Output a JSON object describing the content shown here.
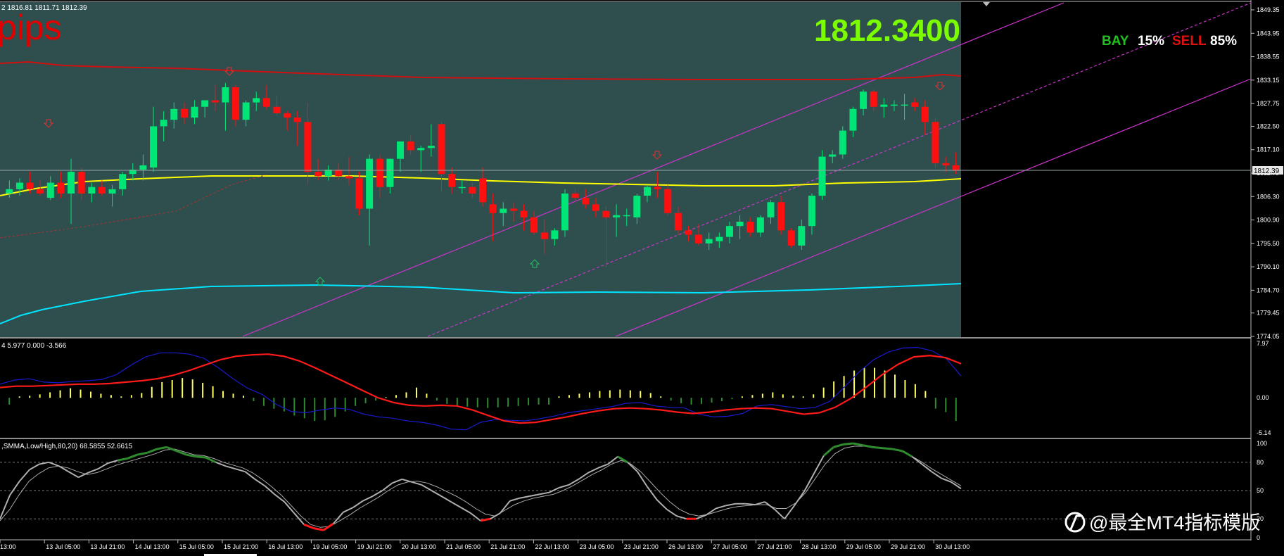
{
  "header": {
    "ohlc_text": "2 1816.81 1811.71 1812.39",
    "pips_label": "pips",
    "price_big": "1812.3400",
    "bay_label": "BAY",
    "bay_pct": "15%",
    "sell_label": "SELL",
    "sell_pct": "85%"
  },
  "macd": {
    "label": "4 5.977 0.000 -3.566"
  },
  "stoch": {
    "label": ",SMMA,Low/High,80,20) 68.5855 52.6615"
  },
  "current_price_tag": "1812.39",
  "watermark": "@最全MT4指标模版",
  "colors": {
    "bull": "#00e676",
    "bear": "#ff1010",
    "main_bg": "#2f4f4f",
    "yellow": "#ffff00",
    "cyan": "#00e5ff",
    "band_red": "#d01010",
    "channel": "#cc33cc",
    "pips": "#e00000",
    "big_price": "#7cfc00"
  },
  "chart_data": {
    "type": "candlestick",
    "price_axis": {
      "range": [
        1774.05,
        1849.35
      ],
      "ticks": [
        "1849.35",
        "1843.95",
        "1838.55",
        "1833.15",
        "1827.75",
        "1822.50",
        "1817.10",
        "1811.70",
        "1806.30",
        "1800.90",
        "1795.50",
        "1790.10",
        "1784.70",
        "1779.45",
        "1774.05"
      ]
    },
    "macd_axis": {
      "ticks": [
        "7.97",
        "0.00",
        "-5.14"
      ]
    },
    "stoch_axis": {
      "ticks": [
        "100",
        "80",
        "50",
        "20",
        "0"
      ]
    },
    "time_axis": {
      "ticks": [
        "13:00",
        "13 Jul 05:00",
        "13 Jul 21:00",
        "14 Jul 13:00",
        "15 Jul 05:00",
        "15 Jul 21:00",
        "16 Jul 13:00",
        "19 Jul 05:00",
        "19 Jul 21:00",
        "20 Jul 13:00",
        "21 Jul 05:00",
        "21 Jul 21:00",
        "22 Jul 13:00",
        "23 Jul 05:00",
        "23 Jul 21:00",
        "26 Jul 13:00",
        "27 Jul 05:00",
        "27 Jul 21:00",
        "28 Jul 13:00",
        "29 Jul 05:00",
        "29 Jul 21:00",
        "30 Jul 13:00"
      ]
    },
    "candles": [
      [
        1807.0,
        1810.0,
        1806.0,
        1808.0
      ],
      [
        1808.0,
        1810.5,
        1806.5,
        1809.5
      ],
      [
        1809.5,
        1812.0,
        1807.0,
        1808.0
      ],
      [
        1808.0,
        1810.0,
        1806.5,
        1807.0
      ],
      [
        1806.0,
        1811.0,
        1805.5,
        1809.5
      ],
      [
        1809.5,
        1812.0,
        1806.0,
        1807.0
      ],
      [
        1807.0,
        1815.0,
        1800.0,
        1812.0
      ],
      [
        1812.0,
        1813.0,
        1805.5,
        1807.0
      ],
      [
        1807.0,
        1809.5,
        1805.0,
        1808.5
      ],
      [
        1808.5,
        1810.0,
        1806.5,
        1807.0
      ],
      [
        1807.0,
        1809.0,
        1804.0,
        1808.0
      ],
      [
        1808.0,
        1812.0,
        1806.5,
        1811.5
      ],
      [
        1811.5,
        1814.0,
        1810.0,
        1812.5
      ],
      [
        1812.5,
        1816.0,
        1810.0,
        1813.5
      ],
      [
        1813.0,
        1827.0,
        1812.0,
        1822.5
      ],
      [
        1822.5,
        1826.0,
        1819.0,
        1824.0
      ],
      [
        1824.0,
        1828.0,
        1822.0,
        1826.5
      ],
      [
        1826.5,
        1828.0,
        1823.0,
        1824.5
      ],
      [
        1824.5,
        1828.5,
        1823.0,
        1827.0
      ],
      [
        1827.0,
        1828.0,
        1824.5,
        1828.5
      ],
      [
        1828.5,
        1832.0,
        1826.0,
        1828.0
      ],
      [
        1828.0,
        1832.5,
        1821.5,
        1831.5
      ],
      [
        1831.5,
        1832.0,
        1822.5,
        1824.0
      ],
      [
        1824.0,
        1828.5,
        1822.5,
        1828.0
      ],
      [
        1828.0,
        1830.5,
        1826.0,
        1829.0
      ],
      [
        1829.0,
        1832.0,
        1826.5,
        1827.0
      ],
      [
        1827.0,
        1829.5,
        1825.0,
        1825.5
      ],
      [
        1825.5,
        1826.0,
        1821.5,
        1824.5
      ],
      [
        1824.5,
        1826.0,
        1818.0,
        1823.5
      ],
      [
        1823.5,
        1828.0,
        1809.0,
        1812.0
      ],
      [
        1812.0,
        1815.0,
        1810.0,
        1811.0
      ],
      [
        1811.0,
        1813.5,
        1810.0,
        1812.5
      ],
      [
        1812.5,
        1814.0,
        1810.0,
        1811.0
      ],
      [
        1811.0,
        1815.5,
        1809.0,
        1810.5
      ],
      [
        1810.5,
        1812.0,
        1802.0,
        1803.5
      ],
      [
        1803.5,
        1816.0,
        1795.0,
        1815.0
      ],
      [
        1815.0,
        1816.0,
        1806.0,
        1808.5
      ],
      [
        1808.5,
        1815.0,
        1807.0,
        1815.0
      ],
      [
        1815.0,
        1819.0,
        1812.0,
        1819.0
      ],
      [
        1819.0,
        1820.5,
        1816.0,
        1817.0
      ],
      [
        1817.0,
        1818.0,
        1812.0,
        1817.5
      ],
      [
        1817.5,
        1823.0,
        1815.5,
        1818.0
      ],
      [
        1823.0,
        1823.5,
        1807.5,
        1811.5
      ],
      [
        1811.5,
        1813.0,
        1807.0,
        1808.5
      ],
      [
        1808.5,
        1810.0,
        1807.0,
        1808.5
      ],
      [
        1808.5,
        1809.5,
        1806.0,
        1807.0
      ],
      [
        1810.5,
        1813.0,
        1804.0,
        1805.0
      ],
      [
        1804.5,
        1807.0,
        1796.0,
        1802.5
      ],
      [
        1802.5,
        1805.0,
        1799.5,
        1803.5
      ],
      [
        1803.5,
        1805.0,
        1800.5,
        1803.0
      ],
      [
        1803.0,
        1804.5,
        1798.5,
        1801.5
      ],
      [
        1801.5,
        1803.0,
        1797.5,
        1798.0
      ],
      [
        1798.0,
        1801.0,
        1793.0,
        1796.5
      ],
      [
        1796.5,
        1799.0,
        1795.0,
        1798.5
      ],
      [
        1798.5,
        1808.0,
        1797.0,
        1807.0
      ],
      [
        1807.0,
        1808.0,
        1805.0,
        1806.0
      ],
      [
        1806.0,
        1808.0,
        1803.5,
        1804.5
      ],
      [
        1804.5,
        1806.0,
        1801.5,
        1803.0
      ],
      [
        1803.0,
        1804.0,
        1790.0,
        1801.5
      ],
      [
        1801.5,
        1804.5,
        1797.0,
        1802.0
      ],
      [
        1802.0,
        1803.5,
        1799.5,
        1802.0
      ],
      [
        1801.5,
        1807.0,
        1800.0,
        1806.5
      ],
      [
        1806.5,
        1809.0,
        1805.0,
        1808.5
      ],
      [
        1808.5,
        1812.0,
        1806.0,
        1808.0
      ],
      [
        1808.0,
        1809.0,
        1802.0,
        1802.5
      ],
      [
        1802.5,
        1804.0,
        1797.5,
        1798.5
      ],
      [
        1798.5,
        1799.5,
        1796.0,
        1797.5
      ],
      [
        1797.5,
        1800.0,
        1795.0,
        1795.5
      ],
      [
        1795.5,
        1798.0,
        1794.0,
        1796.5
      ],
      [
        1796.0,
        1798.0,
        1794.5,
        1797.0
      ],
      [
        1797.0,
        1800.5,
        1795.5,
        1799.5
      ],
      [
        1799.5,
        1802.0,
        1796.5,
        1800.5
      ],
      [
        1800.5,
        1801.5,
        1797.0,
        1798.0
      ],
      [
        1798.0,
        1802.0,
        1797.0,
        1801.5
      ],
      [
        1801.5,
        1805.5,
        1800.0,
        1805.0
      ],
      [
        1805.0,
        1806.5,
        1797.5,
        1798.5
      ],
      [
        1798.5,
        1799.0,
        1794.5,
        1795.0
      ],
      [
        1795.0,
        1801.0,
        1794.0,
        1799.5
      ],
      [
        1799.5,
        1807.0,
        1797.5,
        1806.5
      ],
      [
        1806.5,
        1817.0,
        1805.5,
        1815.5
      ],
      [
        1815.5,
        1817.0,
        1814.0,
        1816.0
      ],
      [
        1816.0,
        1822.5,
        1815.0,
        1821.5
      ],
      [
        1821.5,
        1827.0,
        1820.0,
        1826.5
      ],
      [
        1826.5,
        1831.0,
        1825.0,
        1830.5
      ],
      [
        1830.5,
        1831.0,
        1826.0,
        1827.0
      ],
      [
        1827.0,
        1829.0,
        1824.5,
        1827.5
      ],
      [
        1827.5,
        1828.5,
        1826.0,
        1827.5
      ],
      [
        1827.5,
        1830.0,
        1824.0,
        1827.5
      ],
      [
        1828.0,
        1829.0,
        1826.0,
        1827.0
      ],
      [
        1827.0,
        1828.5,
        1820.5,
        1823.5
      ],
      [
        1823.5,
        1824.5,
        1813.0,
        1814.0
      ],
      [
        1814.0,
        1815.5,
        1812.0,
        1813.5
      ],
      [
        1813.5,
        1816.5,
        1811.5,
        1812.4
      ]
    ],
    "macd_hist": [
      -1.0,
      0.2,
      0.3,
      0.5,
      0.8,
      1.1,
      1.4,
      1.2,
      0.9,
      0.6,
      0.4,
      0.2,
      0.4,
      0.7,
      1.6,
      2.3,
      2.6,
      2.9,
      2.7,
      2.2,
      1.7,
      1.0,
      0.6,
      0.3,
      -0.5,
      -1.2,
      -1.6,
      -2.0,
      -2.6,
      -3.0,
      -3.4,
      -3.3,
      -2.8,
      -2.0,
      -1.2,
      -0.8,
      -0.4,
      0.1,
      0.4,
      0.8,
      1.5,
      0.6,
      -0.4,
      -0.9,
      -1.1,
      -1.3,
      -1.4,
      -1.5,
      -1.4,
      -1.3,
      -1.2,
      -1.1,
      -1.0,
      -1.0,
      0.2,
      0.4,
      0.6,
      0.8,
      1.0,
      1.1,
      1.2,
      1.1,
      1.0,
      0.7,
      0.2,
      -0.4,
      -0.8,
      -1.0,
      -0.9,
      -0.7,
      -0.5,
      -0.2,
      0.2,
      0.4,
      0.6,
      0.8,
      0.5,
      0.3,
      0.2,
      0.5,
      1.5,
      2.4,
      3.2,
      4.0,
      4.4,
      4.4,
      4.0,
      3.4,
      2.6,
      2.0,
      1.0,
      -1.6,
      -2.1,
      -3.4
    ],
    "macd_signal": [
      1.5,
      1.7,
      1.7,
      1.8,
      1.9,
      2.0,
      2.0,
      2.1,
      2.3,
      2.5,
      2.8,
      3.3,
      4.0,
      4.8,
      5.6,
      6.1,
      6.3,
      6.4,
      6.1,
      5.4,
      4.4,
      3.3,
      2.2,
      1.1,
      0.0,
      -0.7,
      -1.1,
      -1.2,
      -1.1,
      -1.2,
      -1.8,
      -2.6,
      -3.4,
      -3.7,
      -3.6,
      -3.2,
      -2.8,
      -2.3,
      -1.9,
      -1.6,
      -1.5,
      -1.6,
      -1.8,
      -2.1,
      -2.3,
      -2.1,
      -1.8,
      -1.6,
      -1.5,
      -1.6,
      -2.0,
      -2.4,
      -2.2,
      -1.4,
      -0.1,
      1.6,
      3.4,
      4.9,
      6.0,
      6.2,
      5.9,
      5.0
    ],
    "macd_main": [
      2.0,
      2.6,
      2.8,
      2.3,
      2.2,
      2.4,
      2.5,
      2.7,
      3.4,
      4.8,
      6.0,
      6.6,
      6.6,
      6.4,
      5.8,
      4.4,
      2.8,
      1.4,
      0.5,
      -1.0,
      -2.0,
      -2.2,
      -1.8,
      -1.5,
      -1.7,
      -2.4,
      -2.8,
      -3.0,
      -3.4,
      -3.6,
      -4.0,
      -4.6,
      -4.7,
      -3.6,
      -3.2,
      -3.3,
      -3.4,
      -3.1,
      -2.7,
      -2.2,
      -1.9,
      -1.6,
      -1.3,
      -0.8,
      -0.7,
      -1.2,
      -1.4,
      -1.5,
      -2.4,
      -2.8,
      -2.7,
      -2.3,
      -1.2,
      -1.0,
      -1.3,
      -1.6,
      -1.4,
      -0.5,
      1.6,
      3.8,
      5.6,
      6.7,
      7.3,
      7.4,
      6.9,
      5.7,
      3.2
    ],
    "stoch_main": [
      20,
      45,
      60,
      72,
      78,
      80,
      76,
      70,
      64,
      69,
      73,
      79,
      82,
      84,
      88,
      90,
      94,
      96,
      92,
      88,
      86,
      85,
      80,
      76,
      73,
      70,
      62,
      55,
      46,
      38,
      26,
      14,
      10,
      8,
      15,
      27,
      32,
      39,
      44,
      50,
      58,
      62,
      59,
      56,
      50,
      44,
      38,
      32,
      26,
      18,
      20,
      26,
      39,
      42,
      44,
      46,
      48,
      53,
      56,
      62,
      69,
      74,
      78,
      86,
      80,
      70,
      54,
      40,
      30,
      23,
      20,
      20,
      24,
      31,
      34,
      36,
      36,
      35,
      38,
      30,
      20,
      34,
      49,
      68,
      87,
      96,
      99,
      100,
      98,
      96,
      95,
      94,
      92,
      86,
      78,
      70,
      63,
      59,
      52
    ],
    "stoch_signal": [
      18,
      30,
      46,
      60,
      68,
      74,
      76,
      74,
      70,
      67,
      69,
      73,
      77,
      80,
      83,
      86,
      89,
      93,
      94,
      91,
      88,
      87,
      84,
      80,
      77,
      74,
      69,
      62,
      54,
      45,
      34,
      23,
      14,
      11,
      12,
      18,
      24,
      31,
      37,
      43,
      50,
      56,
      59,
      60,
      58,
      54,
      49,
      44,
      38,
      31,
      25,
      23,
      29,
      35,
      39,
      42,
      44,
      46,
      50,
      55,
      61,
      67,
      72,
      78,
      82,
      78,
      70,
      59,
      48,
      38,
      30,
      25,
      23,
      25,
      28,
      31,
      33,
      34,
      35,
      35,
      31,
      31,
      37,
      48,
      63,
      78,
      89,
      95,
      97,
      97,
      96,
      95,
      94,
      91,
      86,
      80,
      73,
      67,
      61,
      55
    ]
  }
}
